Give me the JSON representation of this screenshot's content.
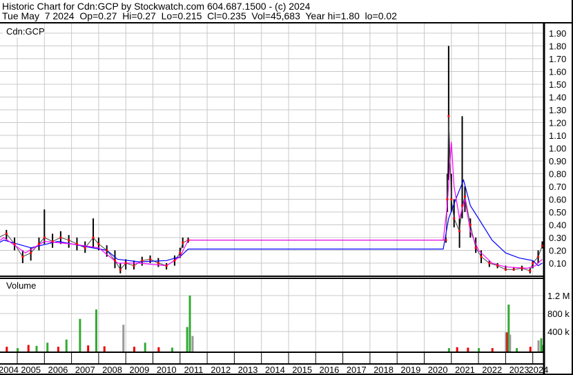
{
  "header": {
    "line1": "Historic Chart for Cdn:GCP by Stockwatch.com 604.687.1500 - (c) 2024",
    "line2": "Tue May  7 2024  Op=0.27  Hi=0.27  Lo=0.215  Cl=0.235  Vol=45,683  Year hi=1.80  lo=0.02"
  },
  "chart_data": {
    "type": "line",
    "title": "Historic Chart for Cdn:GCP",
    "symbol_label": "Cdn:GCP",
    "volume_label": "Volume",
    "price_ylim": [
      0,
      1.95
    ],
    "price_ticks": [
      "0.10",
      "0.20",
      "0.30",
      "0.40",
      "0.50",
      "0.60",
      "0.70",
      "0.80",
      "0.90",
      "1.00",
      "1.10",
      "1.20",
      "1.30",
      "1.40",
      "1.50",
      "1.60",
      "1.70",
      "1.80",
      "1.90"
    ],
    "volume_ticks": [
      {
        "label": "400 k",
        "v": 400
      },
      {
        "label": "800 k",
        "v": 800
      },
      {
        "label": "1.2 M",
        "v": 1200
      }
    ],
    "x_ticks": [
      "2004",
      "2005",
      "2006",
      "2007",
      "2008",
      "2009",
      "2010",
      "2011",
      "2012",
      "2013",
      "2014",
      "2015",
      "2016",
      "2017",
      "2018",
      "2019",
      "2020",
      "2021",
      "2022",
      "2023",
      "2024"
    ],
    "colors": {
      "price": "#000000",
      "close_dot": "#ff0000",
      "ma_short": "#ff00ff",
      "ma_long": "#0000ff",
      "vol_up": "#33aa33",
      "vol_down": "#ee0000",
      "vol_flat": "#999999",
      "grid": "#c8c8c8"
    },
    "price": [
      [
        2004.0,
        0.22,
        0.24,
        0.19
      ],
      [
        2004.3,
        0.3,
        0.36,
        0.26
      ],
      [
        2004.6,
        0.33,
        0.36,
        0.28
      ],
      [
        2004.9,
        0.25,
        0.3,
        0.2
      ],
      [
        2005.2,
        0.15,
        0.2,
        0.1
      ],
      [
        2005.5,
        0.18,
        0.22,
        0.12
      ],
      [
        2005.8,
        0.25,
        0.3,
        0.2
      ],
      [
        2006.0,
        0.3,
        0.52,
        0.25
      ],
      [
        2006.3,
        0.27,
        0.33,
        0.22
      ],
      [
        2006.6,
        0.3,
        0.35,
        0.25
      ],
      [
        2006.9,
        0.28,
        0.32,
        0.22
      ],
      [
        2007.2,
        0.25,
        0.3,
        0.2
      ],
      [
        2007.5,
        0.22,
        0.27,
        0.18
      ],
      [
        2007.8,
        0.3,
        0.45,
        0.22
      ],
      [
        2008.0,
        0.25,
        0.3,
        0.2
      ],
      [
        2008.3,
        0.2,
        0.24,
        0.15
      ],
      [
        2008.6,
        0.12,
        0.2,
        0.06
      ],
      [
        2008.8,
        0.05,
        0.1,
        0.02
      ],
      [
        2009.0,
        0.1,
        0.13,
        0.05
      ],
      [
        2009.3,
        0.08,
        0.12,
        0.05
      ],
      [
        2009.6,
        0.12,
        0.15,
        0.08
      ],
      [
        2009.9,
        0.13,
        0.16,
        0.1
      ],
      [
        2010.2,
        0.1,
        0.14,
        0.07
      ],
      [
        2010.5,
        0.08,
        0.1,
        0.05
      ],
      [
        2010.8,
        0.12,
        0.16,
        0.08
      ],
      [
        2011.0,
        0.18,
        0.22,
        0.14
      ],
      [
        2011.1,
        0.26,
        0.3,
        0.22
      ],
      [
        2011.3,
        0.28,
        0.3,
        0.26
      ],
      [
        2020.8,
        0.28,
        0.3,
        0.26
      ],
      [
        2020.85,
        0.6,
        0.8,
        0.5
      ],
      [
        2020.9,
        1.25,
        1.8,
        0.75
      ],
      [
        2021.0,
        0.6,
        0.8,
        0.5
      ],
      [
        2021.1,
        0.45,
        0.6,
        0.38
      ],
      [
        2021.3,
        0.35,
        0.45,
        0.22
      ],
      [
        2021.4,
        0.55,
        1.25,
        0.45
      ],
      [
        2021.5,
        0.62,
        0.7,
        0.5
      ],
      [
        2021.7,
        0.4,
        0.45,
        0.3
      ],
      [
        2021.9,
        0.22,
        0.3,
        0.18
      ],
      [
        2022.1,
        0.15,
        0.2,
        0.1
      ],
      [
        2022.4,
        0.1,
        0.12,
        0.07
      ],
      [
        2022.7,
        0.08,
        0.1,
        0.06
      ],
      [
        2023.0,
        0.05,
        0.08,
        0.04
      ],
      [
        2023.3,
        0.05,
        0.07,
        0.04
      ],
      [
        2023.6,
        0.06,
        0.08,
        0.04
      ],
      [
        2023.9,
        0.04,
        0.06,
        0.02
      ],
      [
        2024.0,
        0.1,
        0.12,
        0.06
      ],
      [
        2024.2,
        0.15,
        0.2,
        0.1
      ],
      [
        2024.35,
        0.235,
        0.27,
        0.215
      ]
    ],
    "ma_short": [
      [
        2004,
        0.22
      ],
      [
        2004.5,
        0.3
      ],
      [
        2005.3,
        0.18
      ],
      [
        2006,
        0.27
      ],
      [
        2007,
        0.25
      ],
      [
        2008,
        0.22
      ],
      [
        2008.7,
        0.1
      ],
      [
        2009.5,
        0.1
      ],
      [
        2010.5,
        0.08
      ],
      [
        2011.0,
        0.15
      ],
      [
        2011.3,
        0.28
      ],
      [
        2020.7,
        0.28
      ],
      [
        2020.85,
        0.55
      ],
      [
        2021.0,
        1.05
      ],
      [
        2021.1,
        0.7
      ],
      [
        2021.3,
        0.45
      ],
      [
        2021.5,
        0.6
      ],
      [
        2021.7,
        0.35
      ],
      [
        2022.0,
        0.2
      ],
      [
        2022.5,
        0.1
      ],
      [
        2023,
        0.07
      ],
      [
        2023.8,
        0.06
      ],
      [
        2024.1,
        0.08
      ],
      [
        2024.35,
        0.13
      ]
    ],
    "ma_long": [
      [
        2004,
        0.22
      ],
      [
        2004.5,
        0.28
      ],
      [
        2005.5,
        0.22
      ],
      [
        2006.5,
        0.27
      ],
      [
        2007.5,
        0.23
      ],
      [
        2008.3,
        0.2
      ],
      [
        2008.7,
        0.13
      ],
      [
        2009.5,
        0.11
      ],
      [
        2010.5,
        0.12
      ],
      [
        2011.0,
        0.15
      ],
      [
        2011.3,
        0.21
      ],
      [
        2020.7,
        0.21
      ],
      [
        2020.9,
        0.45
      ],
      [
        2021.2,
        0.62
      ],
      [
        2021.45,
        0.75
      ],
      [
        2021.7,
        0.55
      ],
      [
        2022.0,
        0.45
      ],
      [
        2022.5,
        0.28
      ],
      [
        2023.0,
        0.18
      ],
      [
        2023.5,
        0.14
      ],
      [
        2024.0,
        0.12
      ],
      [
        2024.2,
        0.08
      ],
      [
        2024.35,
        0.1
      ]
    ],
    "volume": [
      [
        2004.2,
        40,
        "up"
      ],
      [
        2004.6,
        60,
        "down"
      ],
      [
        2005.0,
        30,
        "up"
      ],
      [
        2005.4,
        100,
        "down"
      ],
      [
        2005.7,
        80,
        "up"
      ],
      [
        2006.1,
        150,
        "up"
      ],
      [
        2006.5,
        60,
        "down"
      ],
      [
        2006.8,
        220,
        "up"
      ],
      [
        2007.3,
        680,
        "up"
      ],
      [
        2007.6,
        90,
        "down"
      ],
      [
        2007.9,
        890,
        "up"
      ],
      [
        2008.2,
        70,
        "down"
      ],
      [
        2008.9,
        550,
        "flat"
      ],
      [
        2009.3,
        60,
        "down"
      ],
      [
        2009.7,
        150,
        "up"
      ],
      [
        2010.2,
        50,
        "down"
      ],
      [
        2010.7,
        40,
        "up"
      ],
      [
        2011.25,
        500,
        "up"
      ],
      [
        2011.35,
        1200,
        "up"
      ],
      [
        2011.45,
        300,
        "flat"
      ],
      [
        2020.9,
        30,
        "up"
      ],
      [
        2021.2,
        50,
        "down"
      ],
      [
        2021.6,
        40,
        "down"
      ],
      [
        2022.0,
        30,
        "up"
      ],
      [
        2022.5,
        30,
        "down"
      ],
      [
        2023.0,
        380,
        "flat"
      ],
      [
        2023.05,
        380,
        "down"
      ],
      [
        2023.1,
        1000,
        "up"
      ],
      [
        2023.15,
        330,
        "flat"
      ],
      [
        2023.4,
        30,
        "up"
      ],
      [
        2023.9,
        60,
        "down"
      ],
      [
        2024.2,
        200,
        "flat"
      ],
      [
        2024.3,
        250,
        "up"
      ],
      [
        2024.35,
        100,
        "up"
      ]
    ]
  }
}
